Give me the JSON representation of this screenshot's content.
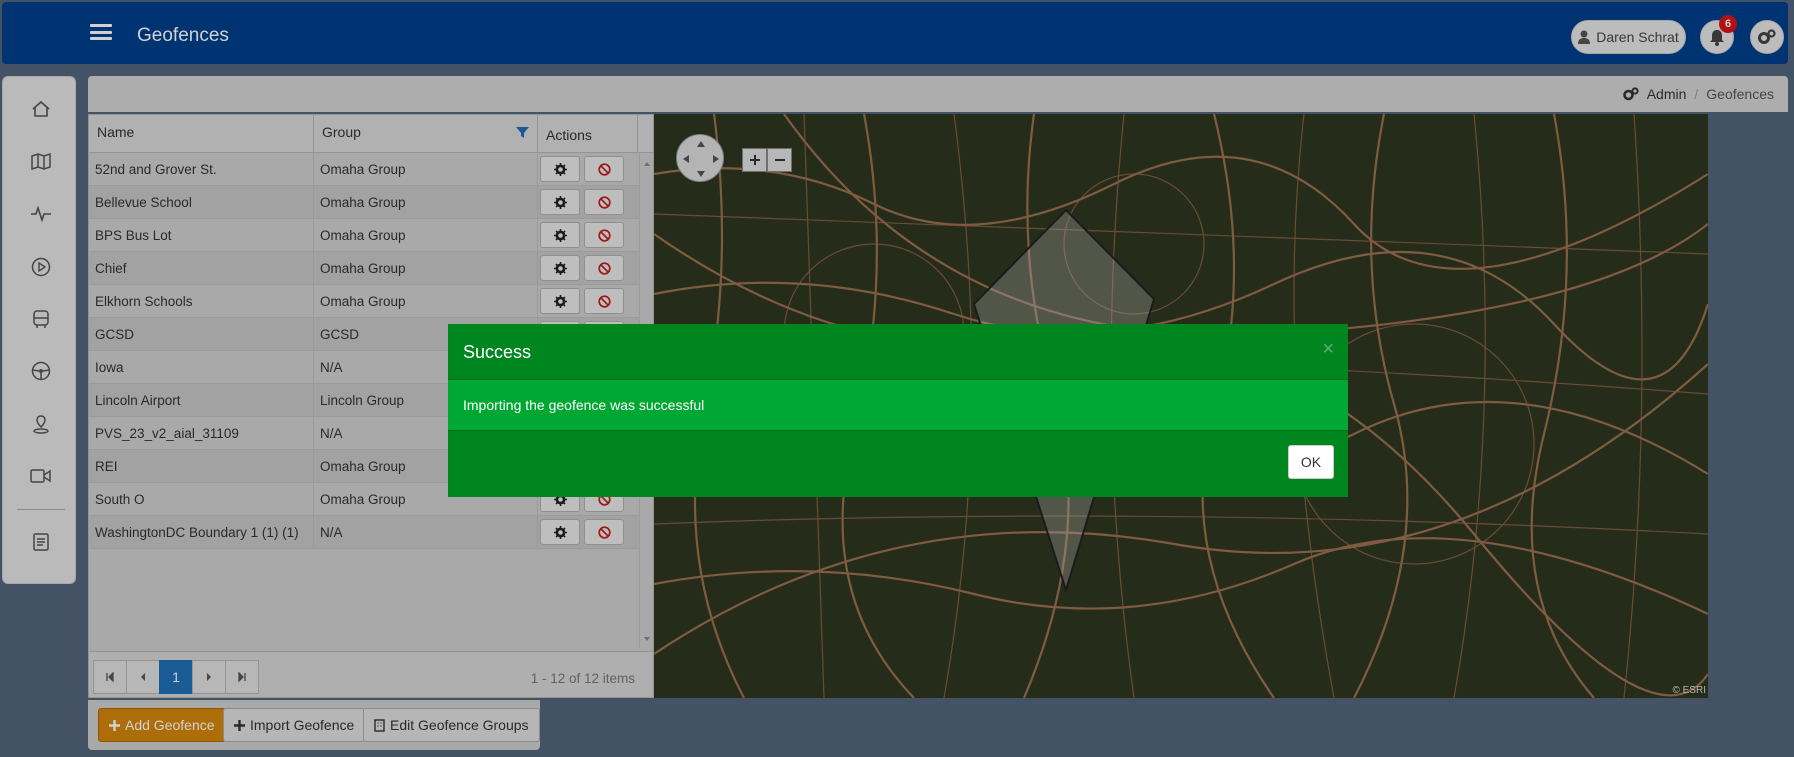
{
  "header": {
    "title": "Geofences",
    "user_name": "Daren Schrat",
    "notification_count": "6"
  },
  "breadcrumb": {
    "admin": "Admin",
    "current": "Geofences"
  },
  "grid": {
    "columns": [
      "Name",
      "Group",
      "Actions"
    ],
    "rows": [
      {
        "name": "52nd and Grover St.",
        "group": "Omaha Group"
      },
      {
        "name": "Bellevue School",
        "group": "Omaha Group"
      },
      {
        "name": "BPS Bus Lot",
        "group": "Omaha Group"
      },
      {
        "name": "Chief",
        "group": "Omaha Group"
      },
      {
        "name": "Elkhorn Schools",
        "group": "Omaha Group"
      },
      {
        "name": "GCSD",
        "group": "GCSD"
      },
      {
        "name": "Iowa",
        "group": "N/A"
      },
      {
        "name": "Lincoln Airport",
        "group": "Lincoln Group"
      },
      {
        "name": "PVS_23_v2_aial_31109",
        "group": "N/A"
      },
      {
        "name": "REI",
        "group": "Omaha Group"
      },
      {
        "name": "South O",
        "group": "Omaha Group"
      },
      {
        "name": "WashingtonDC Boundary 1 (1) (1)",
        "group": "N/A"
      }
    ],
    "pager": {
      "current_page": "1",
      "info": "1 - 12 of 12 items"
    }
  },
  "map": {
    "attribution": "© ESRI"
  },
  "buttons": {
    "add": "Add Geofence",
    "import": "Import Geofence",
    "edit_groups": "Edit Geofence Groups"
  },
  "modal": {
    "title": "Success",
    "message": "Importing the geofence was successful",
    "ok": "OK"
  },
  "colors": {
    "header": "#003f8a",
    "modal_header": "#00861f",
    "modal_body": "#00a833",
    "primary_button": "#d4860a",
    "pager_active": "#1f6fb5"
  }
}
